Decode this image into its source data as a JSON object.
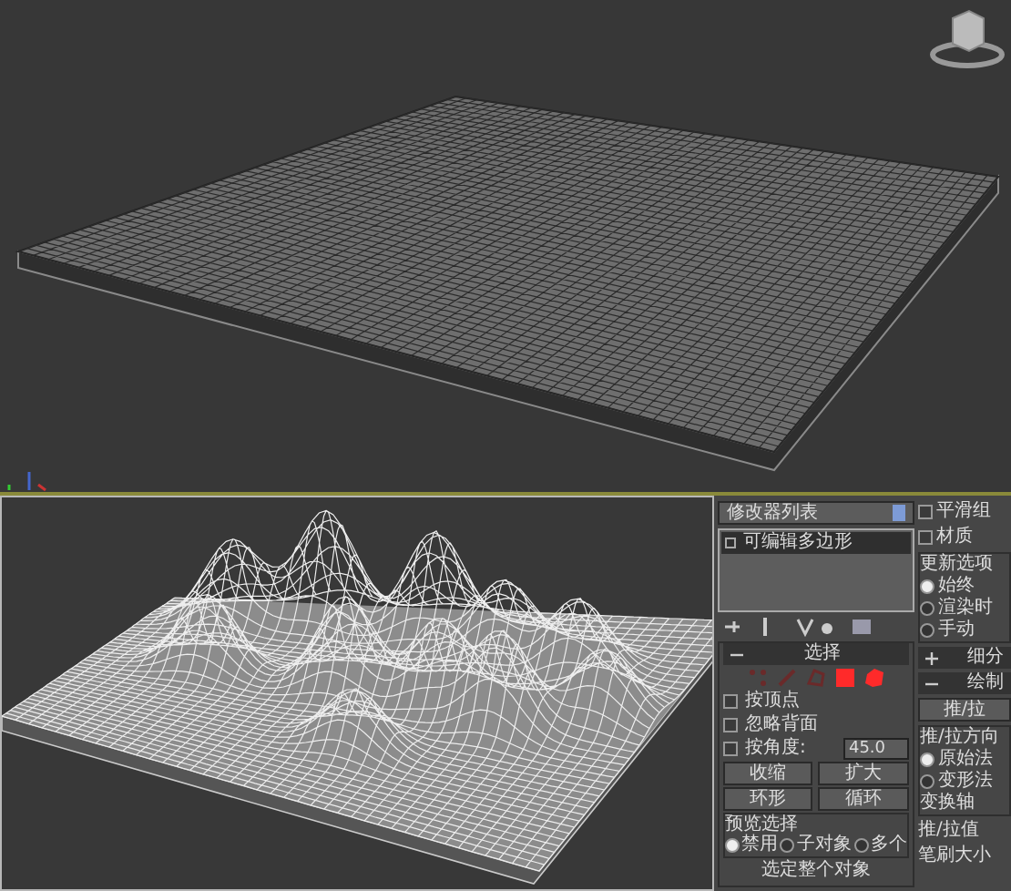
{
  "modifier_panel": {
    "modifier_list": "修改器列表",
    "stack": [
      {
        "label": "可编辑多边形",
        "selected": true
      }
    ],
    "selection_rollout": {
      "title": "选择",
      "expanded": true,
      "subobject_levels": [
        {
          "kind": "vertex",
          "active": false
        },
        {
          "kind": "edge",
          "active": false
        },
        {
          "kind": "border",
          "active": false
        },
        {
          "kind": "polygon",
          "active": true
        },
        {
          "kind": "element",
          "active": true
        }
      ],
      "checkboxes": [
        {
          "label": "按顶点",
          "checked": false
        },
        {
          "label": "忽略背面",
          "checked": false
        },
        {
          "label": "按角度:",
          "checked": false,
          "value": "45.0"
        }
      ],
      "button_rows": [
        [
          "收缩",
          "扩大"
        ],
        [
          "环形",
          "循环"
        ]
      ],
      "preview_selection": {
        "title": "预览选择",
        "options": [
          {
            "label": "禁用",
            "selected": true
          },
          {
            "label": "子对象",
            "selected": false
          },
          {
            "label": "多个",
            "selected": false
          }
        ]
      },
      "select_whole_object": "选定整个对象"
    }
  },
  "subdivision_panel": {
    "checkboxes": [
      {
        "label": "平滑组",
        "checked": false
      },
      {
        "label": "材质",
        "checked": false
      }
    ],
    "update_options": {
      "title": "更新选项",
      "options": [
        {
          "label": "始终",
          "selected": true
        },
        {
          "label": "渲染时",
          "selected": false
        },
        {
          "label": "手动",
          "selected": false
        }
      ]
    },
    "rollouts": [
      {
        "label": "细分",
        "expanded": false
      },
      {
        "label": "绘制",
        "expanded": true
      }
    ],
    "push_pull_button": "推/拉",
    "direction": {
      "title": "推/拉方向",
      "options": [
        {
          "label": "原始法",
          "selected": true
        },
        {
          "label": "变形法",
          "selected": false
        }
      ],
      "axis_label": "变换轴"
    },
    "push_pull_value": "推/拉值",
    "brush_size": "笔刷大小"
  }
}
